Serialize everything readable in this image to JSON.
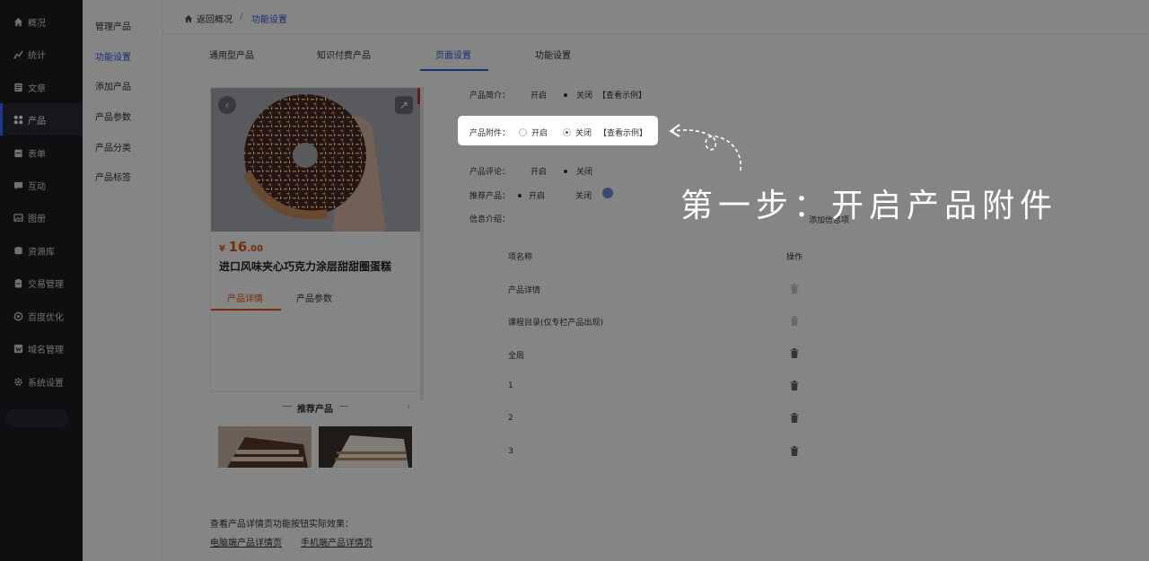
{
  "sidebar": {
    "items": [
      {
        "label": "概况",
        "icon": "home-icon"
      },
      {
        "label": "统计",
        "icon": "chart-icon"
      },
      {
        "label": "文章",
        "icon": "document-icon"
      },
      {
        "label": "产品",
        "icon": "grid-icon"
      },
      {
        "label": "表单",
        "icon": "form-icon"
      },
      {
        "label": "互动",
        "icon": "chat-icon"
      },
      {
        "label": "图册",
        "icon": "image-icon"
      },
      {
        "label": "资源库",
        "icon": "database-icon"
      },
      {
        "label": "交易管理",
        "icon": "clipboard-icon"
      },
      {
        "label": "百度优化",
        "icon": "target-icon"
      },
      {
        "label": "域名管理",
        "icon": "w-icon"
      },
      {
        "label": "系统设置",
        "icon": "gear-icon"
      }
    ]
  },
  "subnav": {
    "items": [
      "管理产品",
      "功能设置",
      "添加产品",
      "产品参数",
      "产品分类",
      "产品标签"
    ]
  },
  "breadcrumb": {
    "back": "返回概况",
    "sep": "/",
    "current": "功能设置"
  },
  "tabs": [
    "通用型产品",
    "知识付费产品",
    "页面设置",
    "功能设置"
  ],
  "preview": {
    "price_currency": "¥",
    "price_int": "16",
    "price_dec": ".00",
    "title": "进口风味夹心巧克力涂层甜甜圈蛋糕",
    "tabs": [
      "产品详情",
      "产品参数"
    ],
    "recommend_title": "推荐产品",
    "recommend_arrow": "›"
  },
  "settings": {
    "intro": {
      "label": "产品简介：",
      "on": "开启",
      "off": "关闭",
      "example": "【查看示例】"
    },
    "attachment": {
      "label": "产品附件：",
      "on": "开启",
      "off": "关闭",
      "example": "【查看示例】"
    },
    "review": {
      "label": "产品评论：",
      "on": "开启",
      "off": "关闭"
    },
    "recommend": {
      "label": "推荐产品：",
      "on": "开启",
      "off": "关闭"
    },
    "info": {
      "label": "信息介绍：",
      "add": "添加信息项"
    }
  },
  "table": {
    "headers": [
      "项名称",
      "操作"
    ],
    "rows": [
      "产品详情",
      "课程目录(仅专栏产品出现)",
      "全局",
      "1",
      "2",
      "3"
    ]
  },
  "footer": {
    "hint": "查看产品详情页功能按钮实际效果：",
    "links": [
      "电脑端产品详情页",
      "手机端产品详情页"
    ]
  },
  "annotation": {
    "step": "第一步：开启产品附件"
  },
  "colors": {
    "accent": "#2f5bd8",
    "price": "#e8590c",
    "sidebar": "#1d1e23"
  }
}
